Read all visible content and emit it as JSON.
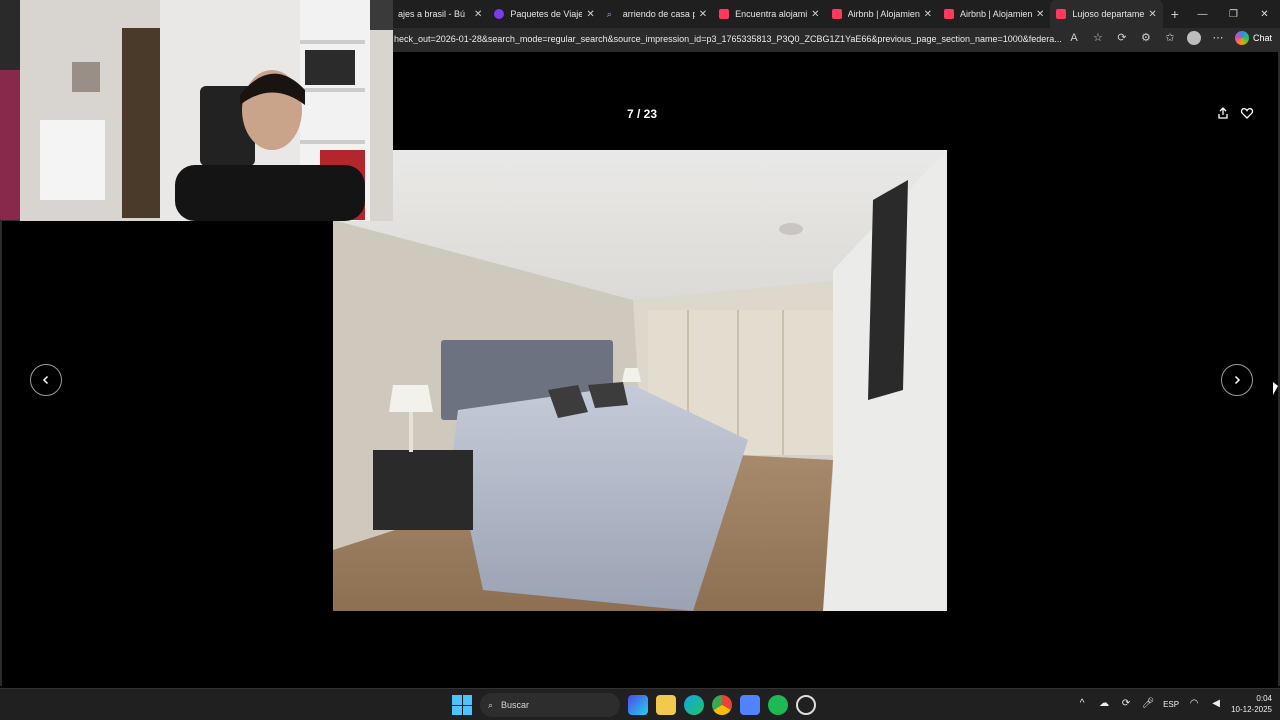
{
  "browser": {
    "tabs": [
      {
        "label": "ajes a brasil - Bú",
        "color": "#e11d48"
      },
      {
        "label": "Paquetes de Viajes",
        "color": "#7c3aed"
      },
      {
        "label": "arriendo de casa po",
        "color": "#3b82f6"
      },
      {
        "label": "Encuentra alojamien",
        "color": "#ff385c"
      },
      {
        "label": "Airbnb | Alojamiento",
        "color": "#ff385c"
      },
      {
        "label": "Airbnb | Alojamiento",
        "color": "#ff385c"
      },
      {
        "label": "Lujoso departament",
        "color": "#ff385c"
      }
    ],
    "active_tab": 6,
    "url": "heck_out=2026-01-28&search_mode=regular_search&source_impression_id=p3_1765335813_P3Q0_ZCBG1Z1YaE66&previous_page_section_name=1000&federa...",
    "chat_label": "Chat",
    "accent": "#ff385c"
  },
  "gallery": {
    "counter": "7 / 23"
  },
  "taskbar": {
    "search_placeholder": "Buscar",
    "language": "ESP",
    "time": "0:04",
    "date": "10-12-2025"
  }
}
